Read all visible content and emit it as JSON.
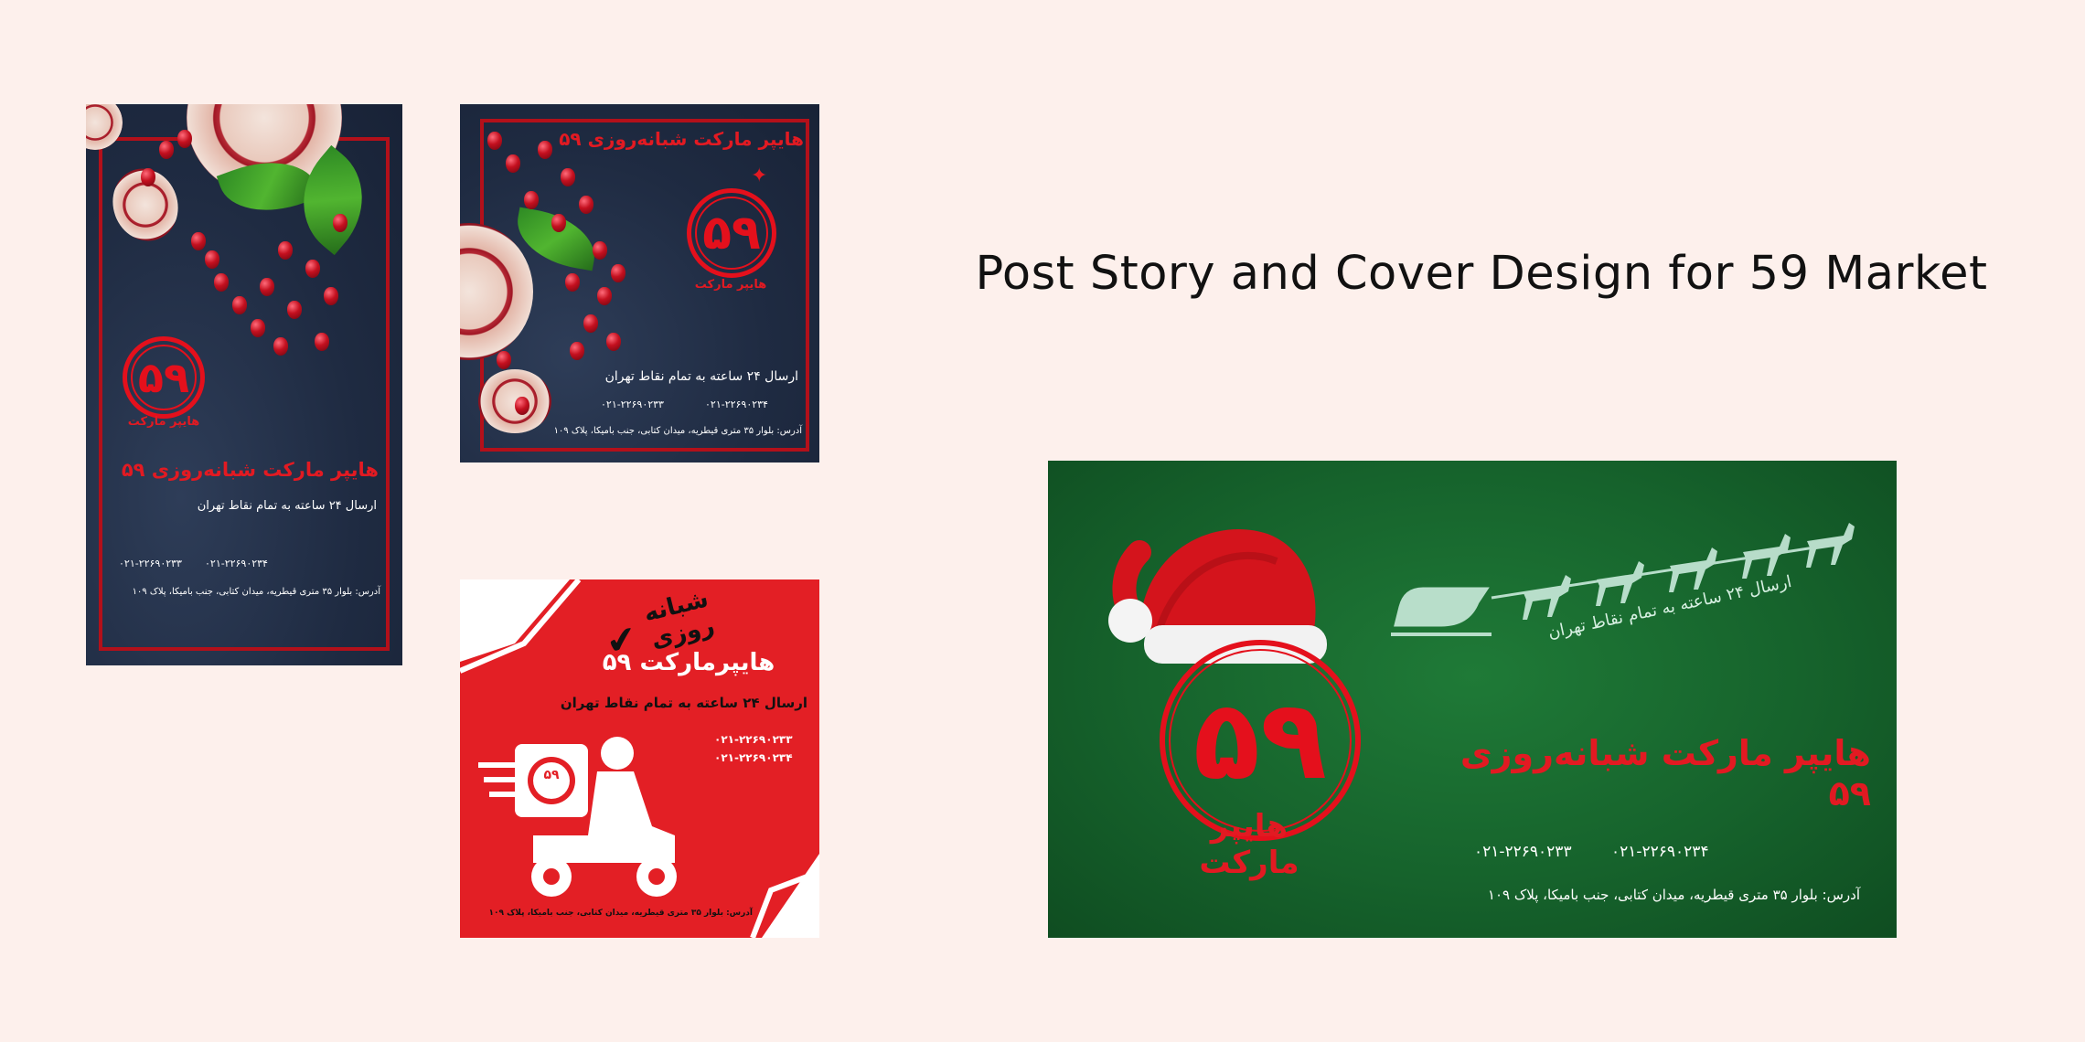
{
  "headline": "Post Story and Cover Design for 59 Market",
  "brand": {
    "number": "۵۹",
    "sub_label": "هایپر مارکت",
    "full_name": "هایپر مارکت شبانه‌روزی ۵۹"
  },
  "delivery_line": "ارسال ۲۴ ساعته به تمام نقاط تهران",
  "phones": [
    "۰۲۱-۲۲۶۹۰۲۳۳",
    "۰۲۱-۲۲۶۹۰۲۳۴"
  ],
  "address": "آدرس: بلوار ۳۵ متری قیطریه، میدان کتابی، جنب بامیکا، پلاک ۱۰۹",
  "red_card": {
    "night_day": "شبانه روزی",
    "title": "هایپرمارکت ۵۹",
    "delivery": "ارسال ۲۴ ساعته به تمام نقاط تهران",
    "phones": [
      "۰۲۱-۲۲۶۹۰۲۳۳",
      "۰۲۱-۲۲۶۹۰۲۳۴"
    ],
    "badge": "۵۹",
    "address": "آدرس: بلوار ۳۵ متری قیطریه، میدان کتابی، جنب بامیکا، پلاک ۱۰۹"
  },
  "colors": {
    "brand_red": "#e21a22",
    "navy": "#1f2b42",
    "green": "#16632c",
    "background": "#fdf0ec"
  },
  "icons": [
    "pomegranate-icon",
    "santa-hat-icon",
    "reindeer-sleigh-icon",
    "delivery-scooter-icon",
    "checkmark-icon",
    "star-ornament-icon"
  ]
}
